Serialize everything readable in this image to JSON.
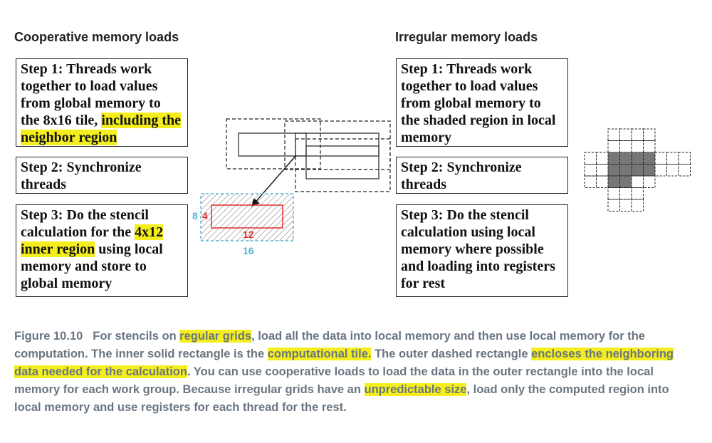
{
  "left": {
    "heading": "Cooperative memory loads",
    "step1": {
      "pre": "Step 1: Threads work together to load values from global memory to the 8x16 tile, ",
      "hl": "including the neighbor region"
    },
    "step2": {
      "text": "Step 2: Synchronize threads"
    },
    "step3": {
      "pre": "Step 3: Do the stencil calculation for the ",
      "hl": "4x12 inner region",
      "post": " using local memory and store to global memory"
    }
  },
  "right": {
    "heading": "Irregular memory loads",
    "step1": {
      "text": "Step 1: Threads work together to load values from global memory to the shaded region in local memory"
    },
    "step2": {
      "text": "Step 2: Synchronize threads"
    },
    "step3": {
      "text": "Step 3: Do the stencil calculation using local memory where possible and loading into registers for rest"
    }
  },
  "tile_labels": {
    "outer_height": "8",
    "inner_height": "4",
    "inner_width": "12",
    "outer_width": "16"
  },
  "colors": {
    "highlight": "#f5ee1e",
    "caption": "#6a7580",
    "tile_outer": "#56b4d3",
    "tile_inner": "#e03030",
    "shaded_cell": "#777777"
  },
  "caption": {
    "figure": "Figure 10.10",
    "t1": "For stencils on ",
    "h1": "regular grids",
    "t2": ", load all the data into local memory and then use local memory for the computation. The inner solid rectangle is the ",
    "h2": "computational tile.",
    "t3": " The outer dashed rectangle ",
    "h3": "encloses the neighboring data needed for the calculation",
    "t4": ". You can use cooperative loads to load the data in the outer rectangle into the local memory for each work group. Because irregular grids have an ",
    "h4": "unpredictable size",
    "t5": ", load only the computed region into local memory and use registers for each thread for the rest."
  }
}
